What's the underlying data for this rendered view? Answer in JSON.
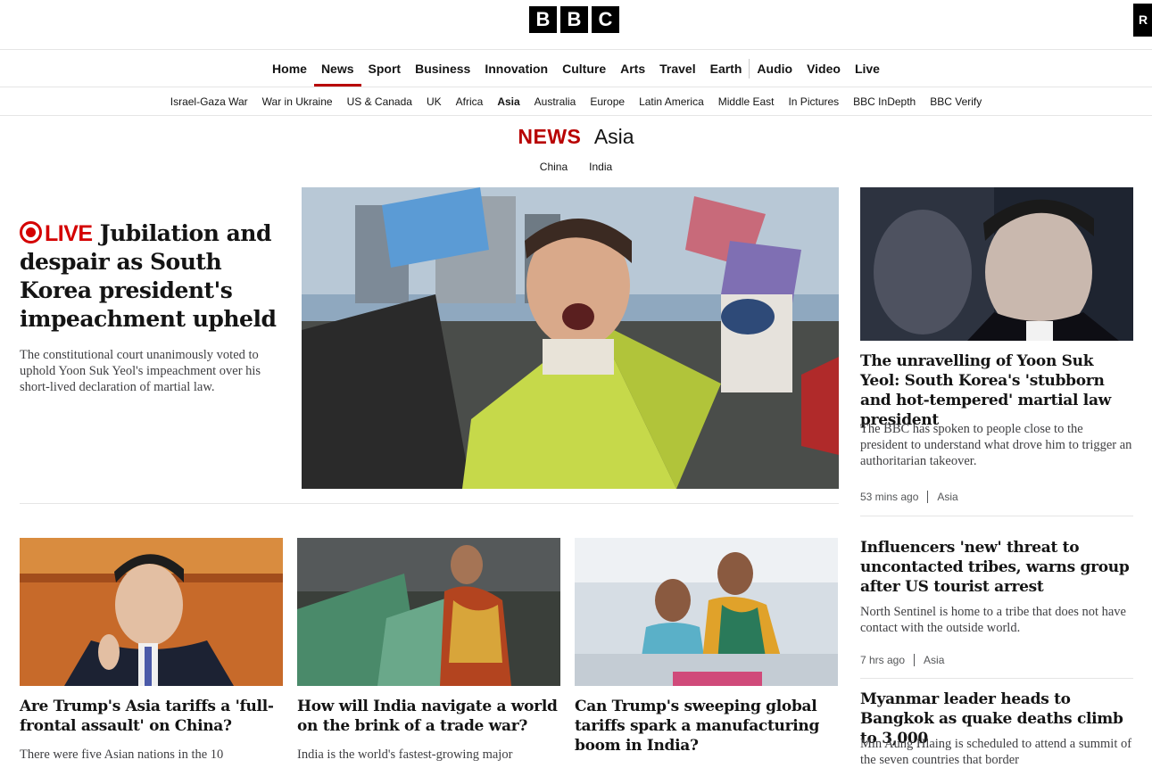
{
  "header": {
    "logo": [
      "B",
      "B",
      "C"
    ],
    "signin_glyph": "R"
  },
  "primary_nav": [
    {
      "label": "Home"
    },
    {
      "label": "News",
      "active": true
    },
    {
      "label": "Sport"
    },
    {
      "label": "Business"
    },
    {
      "label": "Innovation"
    },
    {
      "label": "Culture"
    },
    {
      "label": "Arts"
    },
    {
      "label": "Travel"
    },
    {
      "label": "Earth"
    },
    {
      "label": "Audio"
    },
    {
      "label": "Video"
    },
    {
      "label": "Live"
    }
  ],
  "secondary_nav": [
    {
      "label": "Israel-Gaza War"
    },
    {
      "label": "War in Ukraine"
    },
    {
      "label": "US & Canada"
    },
    {
      "label": "UK"
    },
    {
      "label": "Africa"
    },
    {
      "label": "Asia",
      "active": true
    },
    {
      "label": "Australia"
    },
    {
      "label": "Europe"
    },
    {
      "label": "Latin America"
    },
    {
      "label": "Middle East"
    },
    {
      "label": "In Pictures"
    },
    {
      "label": "BBC InDepth"
    },
    {
      "label": "BBC Verify"
    }
  ],
  "section": {
    "news_label": "NEWS",
    "region": "Asia",
    "subnav": [
      "China",
      "India"
    ]
  },
  "lead": {
    "live_label": "LIVE",
    "headline": "Jubilation and despair as South Korea president's impeachment upheld",
    "summary": "The constitutional court unanimously voted to uphold Yoon Suk Yeol's impeachment over his short-lived declaration of martial law."
  },
  "right_column": [
    {
      "title": "The unravelling of Yoon Suk Yeol: South Korea's 'stubborn and hot-tempered' martial law president",
      "summary": "The BBC has spoken to people close to the president to understand what drove him to trigger an authoritarian takeover.",
      "time": "53 mins ago",
      "tag": "Asia"
    },
    {
      "title": "Influencers 'new' threat to uncontacted tribes, warns group after US tourist arrest",
      "summary": "North Sentinel is home to a tribe that does not have contact with the outside world.",
      "time": "7 hrs ago",
      "tag": "Asia"
    },
    {
      "title": "Myanmar leader heads to Bangkok as quake deaths climb to 3,000",
      "summary": "Min Aung Hlaing is scheduled to attend a summit of the seven countries that border"
    }
  ],
  "cards": [
    {
      "title": "Are Trump's Asia tariffs a 'full-frontal assault' on China?",
      "summary": "There were five Asian nations in the 10"
    },
    {
      "title": "How will India navigate a world on the brink of a trade war?",
      "summary": "India is the world's fastest-growing major"
    },
    {
      "title": "Can Trump's sweeping global tariffs spark a manufacturing boom in India?",
      "summary": ""
    }
  ],
  "colors": {
    "brand_red": "#b80000",
    "live_red": "#d40000"
  }
}
